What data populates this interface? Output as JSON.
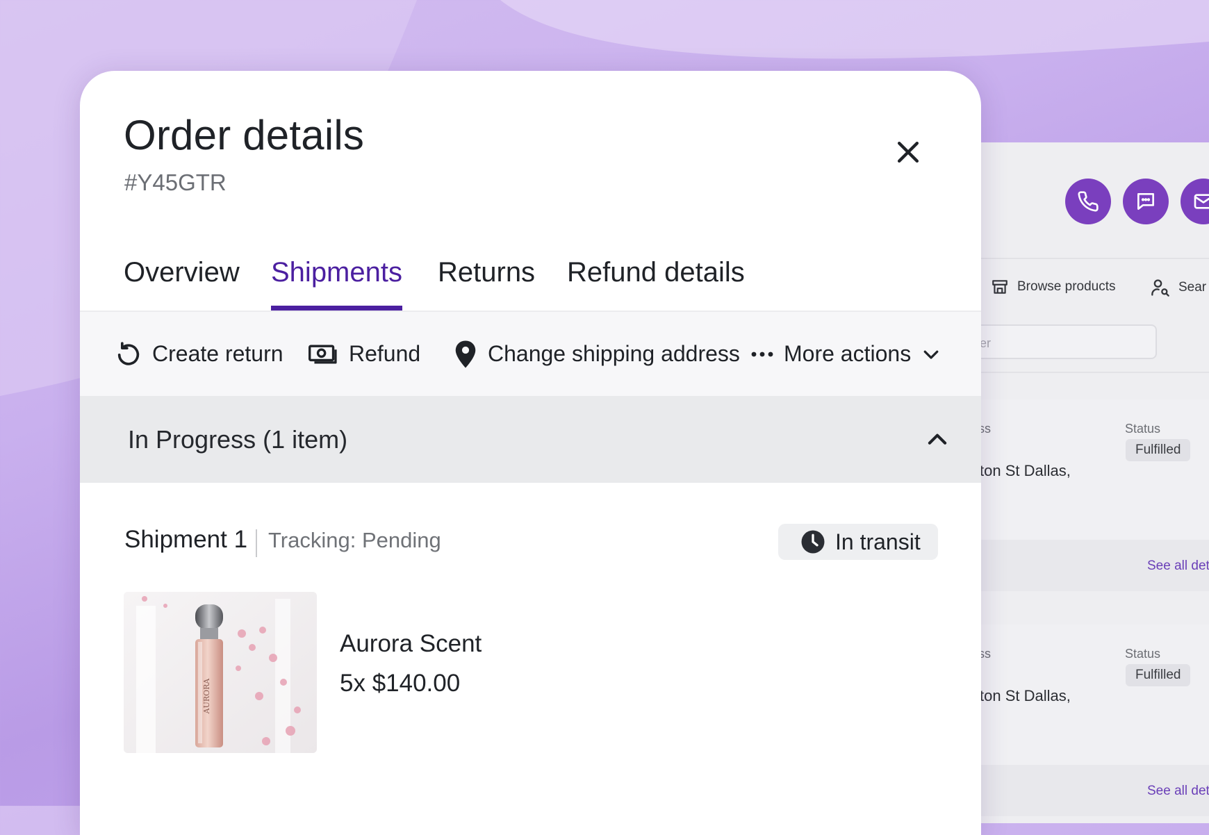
{
  "modal": {
    "title": "Order details",
    "order_id": "#Y45GTR",
    "close_icon": "close-icon"
  },
  "tabs": [
    {
      "label": "Overview",
      "active": false
    },
    {
      "label": "Shipments",
      "active": true
    },
    {
      "label": "Returns",
      "active": false
    },
    {
      "label": "Refund details",
      "active": false
    }
  ],
  "actions": {
    "create_return": "Create return",
    "refund": "Refund",
    "change_address": "Change shipping address",
    "more_actions": "More actions"
  },
  "section": {
    "title": "In Progress (1 item)",
    "expanded": true
  },
  "shipment": {
    "title": "Shipment 1",
    "tracking": "Tracking: Pending",
    "status": "In transit",
    "status_icon": "clock-icon"
  },
  "product": {
    "name": "Aurora Scent",
    "quantity_price": "5x $140.00",
    "bottle_text": "AURORA"
  },
  "background_panel": {
    "browse_products": "Browse products",
    "search": "Sear",
    "search_placeholder": "per",
    "orders": [
      {
        "address_label": "ss",
        "status_label": "Status",
        "status": "Fulfilled",
        "address": "ton St Dallas,",
        "link": "See all det"
      },
      {
        "address_label": "ss",
        "status_label": "Status",
        "status": "Fulfilled",
        "address": "ton St Dallas,",
        "link": "See all det"
      }
    ]
  },
  "colors": {
    "accent": "#4b1fa0",
    "brand_button": "#7a3fbe",
    "background": "#c9b0ee"
  }
}
